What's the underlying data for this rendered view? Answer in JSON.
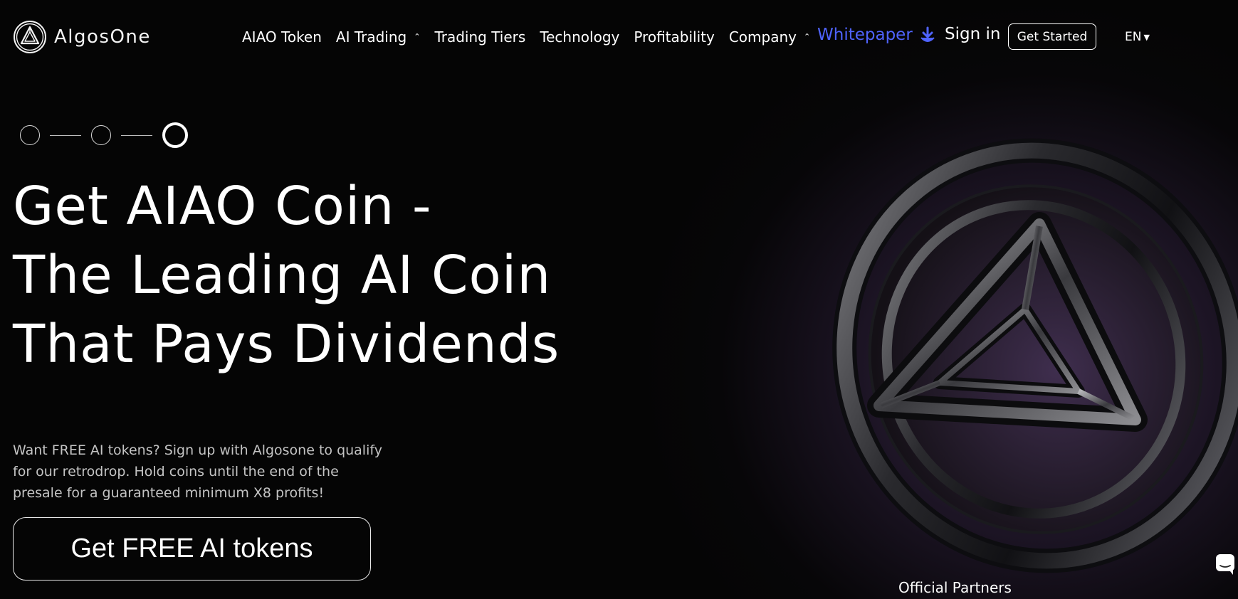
{
  "brand": {
    "name": "AlgosOne",
    "logo_icon": "algosone-logo-icon"
  },
  "nav": {
    "items": [
      {
        "label": "AIAO Token",
        "has_dropdown": false
      },
      {
        "label": "AI Trading",
        "has_dropdown": true
      },
      {
        "label": "Trading Tiers",
        "has_dropdown": false
      },
      {
        "label": "Technology",
        "has_dropdown": false
      },
      {
        "label": "Profitability",
        "has_dropdown": false
      },
      {
        "label": "Company",
        "has_dropdown": true
      }
    ],
    "whitepaper": "Whitepaper",
    "whitepaper_icon": "download-icon",
    "signin": "Sign in",
    "get_started": "Get Started",
    "language": "EN"
  },
  "slider": {
    "steps": 3,
    "active_step": 3
  },
  "hero": {
    "title_lines": [
      "Get AIAO Coin -",
      "The Leading AI Coin",
      "That Pays Dividends"
    ],
    "description": "Want FREE AI tokens? Sign up with Algosone to qualify for our retrodrop. Hold coins until the end of the presale for a guaranteed minimum X8 profits!",
    "cta": "Get FREE AI tokens"
  },
  "partners": {
    "title": "Official Partners"
  },
  "colors": {
    "background": "#050505",
    "whitepaper_accent": "#4f63ff",
    "coin_glow": "#3a2a48",
    "description_text": "#c4c4c4"
  }
}
